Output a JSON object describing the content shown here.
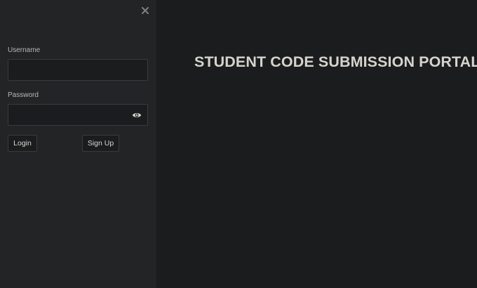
{
  "sidebar": {
    "close_icon": "close-icon",
    "username": {
      "label": "Username",
      "value": "",
      "placeholder": ""
    },
    "password": {
      "label": "Password",
      "value": "",
      "placeholder": "",
      "toggle_icon": "eye-icon"
    },
    "login_label": "Login",
    "signup_label": "Sign Up"
  },
  "main": {
    "title": "STUDENT CODE SUBMISSION PORTAL"
  },
  "colors": {
    "background": "#1b1c1e",
    "sidebar_background": "#232426",
    "input_border": "#3a3b3e",
    "title_text": "#d6d3cc",
    "label_text": "#b9b8b4"
  }
}
